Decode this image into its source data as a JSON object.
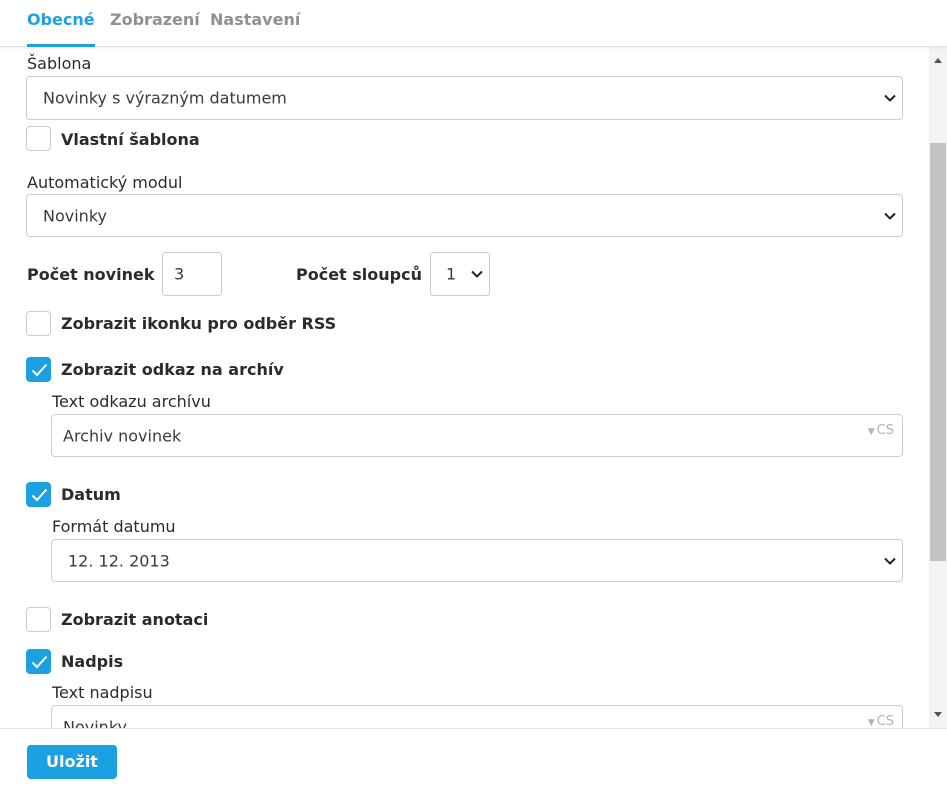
{
  "tabs": [
    {
      "label": "Obecné",
      "active": true
    },
    {
      "label": "Zobrazení",
      "active": false
    },
    {
      "label": "Nastavení",
      "active": false
    }
  ],
  "form": {
    "template_label": "Šablona",
    "template_value": "Novinky s výrazným datumem",
    "custom_template_label": "Vlastní šablona",
    "custom_template_checked": false,
    "auto_module_label": "Automatický modul",
    "auto_module_value": "Novinky",
    "news_count_label": "Počet novinek",
    "news_count_value": "3",
    "columns_label": "Počet sloupců",
    "columns_value": "1",
    "rss_label": "Zobrazit ikonku pro odběr RSS",
    "rss_checked": false,
    "archive_link_label": "Zobrazit odkaz na archív",
    "archive_link_checked": true,
    "archive_text_label": "Text odkazu archívu",
    "archive_text_value": "Archiv novinek",
    "archive_text_lang": "CS",
    "date_label": "Datum",
    "date_checked": true,
    "date_format_label": "Formát datumu",
    "date_format_value": "12. 12. 2013",
    "annotation_label": "Zobrazit anotaci",
    "annotation_checked": false,
    "heading_label": "Nadpis",
    "heading_checked": true,
    "heading_text_label": "Text nadpisu",
    "heading_text_value": "Novinky",
    "heading_text_lang": "CS"
  },
  "footer": {
    "save_label": "Uložit"
  },
  "colors": {
    "accent": "#1ba1e2",
    "tab_inactive": "#8d9197",
    "border": "#c9cdd1"
  },
  "icons": {
    "select": "chevron-down-icon",
    "checkbox": "check-icon",
    "lang": "caret-down-icon"
  }
}
